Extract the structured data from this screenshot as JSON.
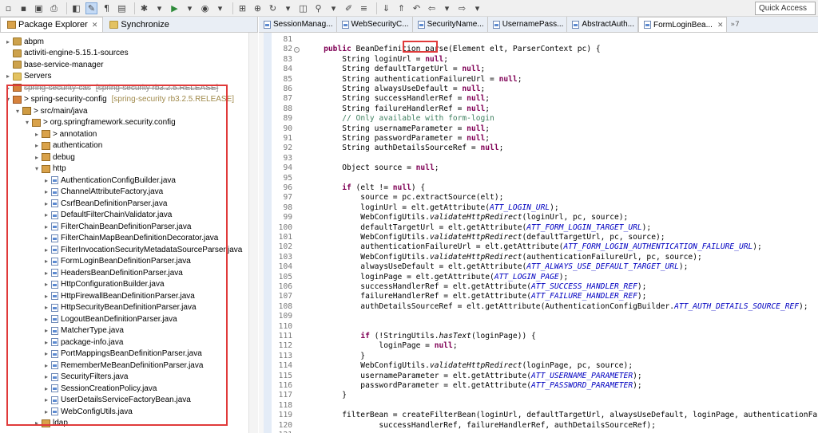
{
  "toolbar": {
    "quick_access": "Quick Access",
    "accent": "#c4daf5"
  },
  "left_panel": {
    "tabs": [
      {
        "label": "Package Explorer",
        "icon": "package-explorer-icon"
      },
      {
        "label": "Synchronize",
        "icon": "synchronize-icon"
      }
    ],
    "tree": [
      {
        "label": "abpm",
        "depth": 0,
        "icon": "project",
        "expand": ">"
      },
      {
        "label": "activiti-engine-5.15.1-sources",
        "depth": 0,
        "icon": "project",
        "expand": ""
      },
      {
        "label": "base-service-manager",
        "depth": 0,
        "icon": "project",
        "expand": ""
      },
      {
        "label": "Servers",
        "depth": 0,
        "icon": "folder",
        "expand": ">"
      },
      {
        "label": "spring-security-cas",
        "depth": 0,
        "icon": "project-s",
        "expand": ">",
        "note": "[spring-security rb3.2.5.RELEASE]",
        "struck": true
      },
      {
        "label": "> spring-security-config",
        "depth": 0,
        "icon": "project-s",
        "expand": "v",
        "note": "[spring-security rb3.2.5.RELEASE]"
      },
      {
        "label": "> src/main/java",
        "depth": 1,
        "icon": "src",
        "expand": "v"
      },
      {
        "label": "> org.springframework.security.config",
        "depth": 2,
        "icon": "pkg",
        "expand": "v"
      },
      {
        "label": "> annotation",
        "depth": 3,
        "icon": "pkg",
        "expand": ">"
      },
      {
        "label": "authentication",
        "depth": 3,
        "icon": "pkg",
        "expand": ">"
      },
      {
        "label": "debug",
        "depth": 3,
        "icon": "pkg",
        "expand": ">"
      },
      {
        "label": "http",
        "depth": 3,
        "icon": "pkg",
        "expand": "v"
      },
      {
        "label": "AuthenticationConfigBuilder.java",
        "depth": 4,
        "icon": "java",
        "expand": ">"
      },
      {
        "label": "ChannelAttributeFactory.java",
        "depth": 4,
        "icon": "java",
        "expand": ">"
      },
      {
        "label": "CsrfBeanDefinitionParser.java",
        "depth": 4,
        "icon": "java",
        "expand": ">"
      },
      {
        "label": "DefaultFilterChainValidator.java",
        "depth": 4,
        "icon": "java",
        "expand": ">"
      },
      {
        "label": "FilterChainBeanDefinitionParser.java",
        "depth": 4,
        "icon": "java",
        "expand": ">"
      },
      {
        "label": "FilterChainMapBeanDefinitionDecorator.java",
        "depth": 4,
        "icon": "java",
        "expand": ">"
      },
      {
        "label": "FilterInvocationSecurityMetadataSourceParser.java",
        "depth": 4,
        "icon": "java",
        "expand": ">"
      },
      {
        "label": "FormLoginBeanDefinitionParser.java",
        "depth": 4,
        "icon": "java",
        "expand": ">"
      },
      {
        "label": "HeadersBeanDefinitionParser.java",
        "depth": 4,
        "icon": "java",
        "expand": ">"
      },
      {
        "label": "HttpConfigurationBuilder.java",
        "depth": 4,
        "icon": "java",
        "expand": ">"
      },
      {
        "label": "HttpFirewallBeanDefinitionParser.java",
        "depth": 4,
        "icon": "java",
        "expand": ">"
      },
      {
        "label": "HttpSecurityBeanDefinitionParser.java",
        "depth": 4,
        "icon": "java",
        "expand": ">"
      },
      {
        "label": "LogoutBeanDefinitionParser.java",
        "depth": 4,
        "icon": "java",
        "expand": ">"
      },
      {
        "label": "MatcherType.java",
        "depth": 4,
        "icon": "java",
        "expand": ">"
      },
      {
        "label": "package-info.java",
        "depth": 4,
        "icon": "java",
        "expand": ">"
      },
      {
        "label": "PortMappingsBeanDefinitionParser.java",
        "depth": 4,
        "icon": "java",
        "expand": ">"
      },
      {
        "label": "RememberMeBeanDefinitionParser.java",
        "depth": 4,
        "icon": "java",
        "expand": ">"
      },
      {
        "label": "SecurityFilters.java",
        "depth": 4,
        "icon": "java",
        "expand": ">"
      },
      {
        "label": "SessionCreationPolicy.java",
        "depth": 4,
        "icon": "java",
        "expand": ">"
      },
      {
        "label": "UserDetailsServiceFactoryBean.java",
        "depth": 4,
        "icon": "java",
        "expand": ">"
      },
      {
        "label": "WebConfigUtils.java",
        "depth": 4,
        "icon": "java",
        "expand": ">"
      },
      {
        "label": "ldap",
        "depth": 3,
        "icon": "pkg",
        "expand": ">"
      }
    ]
  },
  "editor": {
    "tabs": [
      {
        "label": "SessionManag..."
      },
      {
        "label": "WebSecurityC..."
      },
      {
        "label": "SecurityName..."
      },
      {
        "label": "UsernamePass..."
      },
      {
        "label": "AbstractAuth..."
      },
      {
        "label": "FormLoginBea...",
        "active": true
      }
    ],
    "more_tabs": "»7",
    "lines": [
      {
        "n": "81",
        "html": ""
      },
      {
        "n": "82",
        "html": "    <span class='kw'>public</span> BeanDefinition parse(Element elt, ParserContext pc) {"
      },
      {
        "n": "83",
        "html": "        String loginUrl = <span class='kw'>null</span>;"
      },
      {
        "n": "84",
        "html": "        String defaultTargetUrl = <span class='kw'>null</span>;"
      },
      {
        "n": "85",
        "html": "        String authenticationFailureUrl = <span class='kw'>null</span>;"
      },
      {
        "n": "86",
        "html": "        String alwaysUseDefault = <span class='kw'>null</span>;"
      },
      {
        "n": "87",
        "html": "        String successHandlerRef = <span class='kw'>null</span>;"
      },
      {
        "n": "88",
        "html": "        String failureHandlerRef = <span class='kw'>null</span>;"
      },
      {
        "n": "89",
        "html": "        <span class='cm'>// Only available with form-login</span>"
      },
      {
        "n": "90",
        "html": "        String usernameParameter = <span class='kw'>null</span>;"
      },
      {
        "n": "91",
        "html": "        String passwordParameter = <span class='kw'>null</span>;"
      },
      {
        "n": "92",
        "html": "        String authDetailsSourceRef = <span class='kw'>null</span>;"
      },
      {
        "n": "93",
        "html": ""
      },
      {
        "n": "94",
        "html": "        Object source = <span class='kw'>null</span>;"
      },
      {
        "n": "95",
        "html": ""
      },
      {
        "n": "96",
        "html": "        <span class='kw'>if</span> (elt != <span class='kw'>null</span>) {"
      },
      {
        "n": "97",
        "html": "            source = pc.extractSource(elt);"
      },
      {
        "n": "98",
        "html": "            loginUrl = elt.getAttribute(<span class='st'>ATT_LOGIN_URL</span>);"
      },
      {
        "n": "99",
        "html": "            WebConfigUtils.<span class='it'>validateHttpRedirect</span>(loginUrl, pc, source);"
      },
      {
        "n": "100",
        "html": "            defaultTargetUrl = elt.getAttribute(<span class='st'>ATT_FORM_LOGIN_TARGET_URL</span>);"
      },
      {
        "n": "101",
        "html": "            WebConfigUtils.<span class='it'>validateHttpRedirect</span>(defaultTargetUrl, pc, source);"
      },
      {
        "n": "102",
        "html": "            authenticationFailureUrl = elt.getAttribute(<span class='st'>ATT_FORM_LOGIN_AUTHENTICATION_FAILURE_URL</span>);"
      },
      {
        "n": "103",
        "html": "            WebConfigUtils.<span class='it'>validateHttpRedirect</span>(authenticationFailureUrl, pc, source);"
      },
      {
        "n": "104",
        "html": "            alwaysUseDefault = elt.getAttribute(<span class='st'>ATT_ALWAYS_USE_DEFAULT_TARGET_URL</span>);"
      },
      {
        "n": "105",
        "html": "            loginPage = elt.getAttribute(<span class='st'>ATT_LOGIN_PAGE</span>);"
      },
      {
        "n": "106",
        "html": "            successHandlerRef = elt.getAttribute(<span class='st'>ATT_SUCCESS_HANDLER_REF</span>);"
      },
      {
        "n": "107",
        "html": "            failureHandlerRef = elt.getAttribute(<span class='st'>ATT_FAILURE_HANDLER_REF</span>);"
      },
      {
        "n": "108",
        "html": "            authDetailsSourceRef = elt.getAttribute(AuthenticationConfigBuilder.<span class='st'>ATT_AUTH_DETAILS_SOURCE_REF</span>);"
      },
      {
        "n": "109",
        "html": ""
      },
      {
        "n": "110",
        "html": ""
      },
      {
        "n": "111",
        "html": "            <span class='kw'>if</span> (!StringUtils.<span class='it'>hasText</span>(loginPage)) {"
      },
      {
        "n": "112",
        "html": "                loginPage = <span class='kw'>null</span>;"
      },
      {
        "n": "113",
        "html": "            }"
      },
      {
        "n": "114",
        "html": "            WebConfigUtils.<span class='it'>validateHttpRedirect</span>(loginPage, pc, source);"
      },
      {
        "n": "115",
        "html": "            usernameParameter = elt.getAttribute(<span class='st'>ATT_USERNAME_PARAMETER</span>);"
      },
      {
        "n": "116",
        "html": "            passwordParameter = elt.getAttribute(<span class='st'>ATT_PASSWORD_PARAMETER</span>);"
      },
      {
        "n": "117",
        "html": "        }"
      },
      {
        "n": "118",
        "html": ""
      },
      {
        "n": "119",
        "html": "        filterBean = createFilterBean(loginUrl, defaultTargetUrl, alwaysUseDefault, loginPage, authenticationFailu"
      },
      {
        "n": "120",
        "html": "                successHandlerRef, failureHandlerRef, authDetailsSourceRef);"
      },
      {
        "n": "121",
        "html": ""
      }
    ]
  }
}
